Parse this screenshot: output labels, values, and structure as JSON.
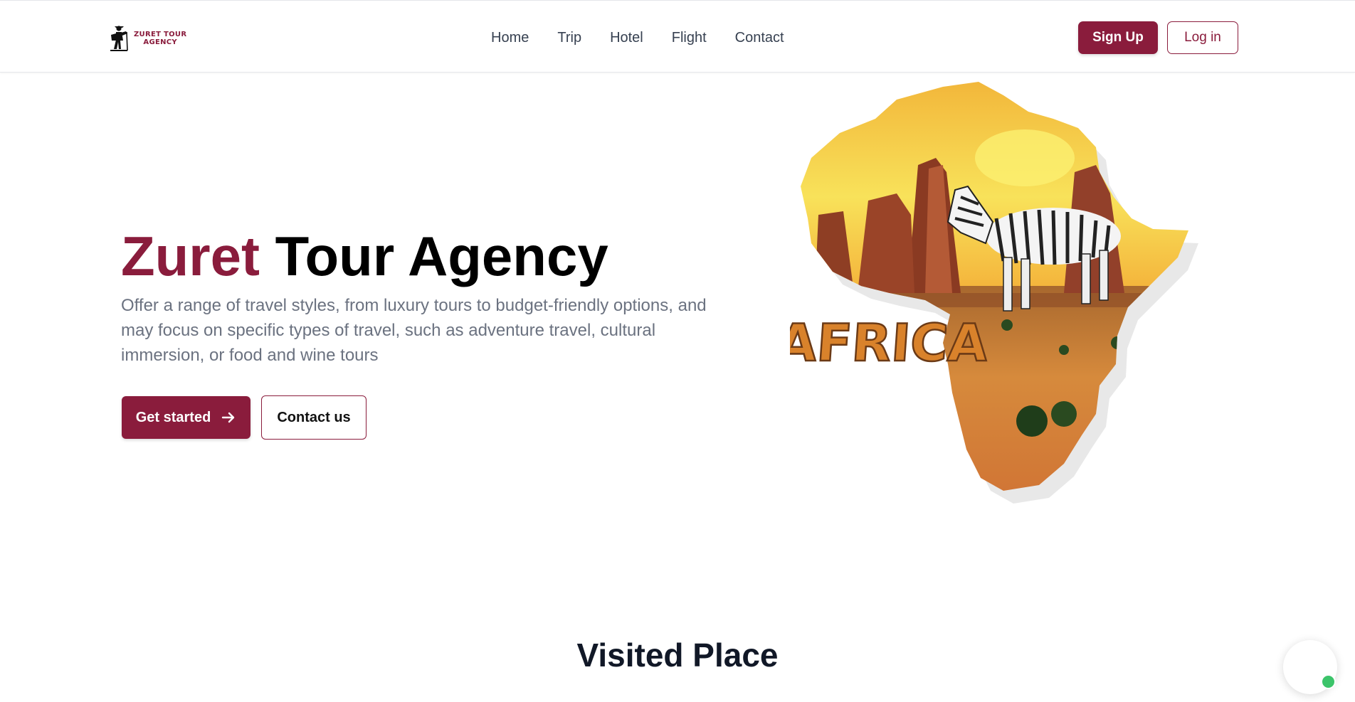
{
  "brand": {
    "name_line1": "ZURET TOUR",
    "name_line2": "AGENCY",
    "color": "#8a1c3c"
  },
  "nav": {
    "links": [
      {
        "label": "Home"
      },
      {
        "label": "Trip"
      },
      {
        "label": "Hotel"
      },
      {
        "label": "Flight"
      },
      {
        "label": "Contact"
      }
    ],
    "signup_label": "Sign Up",
    "login_label": "Log in"
  },
  "hero": {
    "title_accent": "Zuret",
    "title_rest": "Tour Agency",
    "description": "Offer a range of travel styles, from luxury tours to budget-friendly options, and may focus on specific types of travel, such as adventure travel, cultural immersion, or food and wine tours",
    "cta_primary": "Get started",
    "cta_secondary": "Contact us",
    "illustration_text": "AFRICA"
  },
  "section": {
    "title": "Visited Place"
  },
  "icons": [
    "hiker-logo-icon",
    "arrow-right-icon",
    "chat-icon",
    "online-status-icon"
  ],
  "colors": {
    "accent": "#8a1c3c",
    "online": "#3cc46a"
  }
}
